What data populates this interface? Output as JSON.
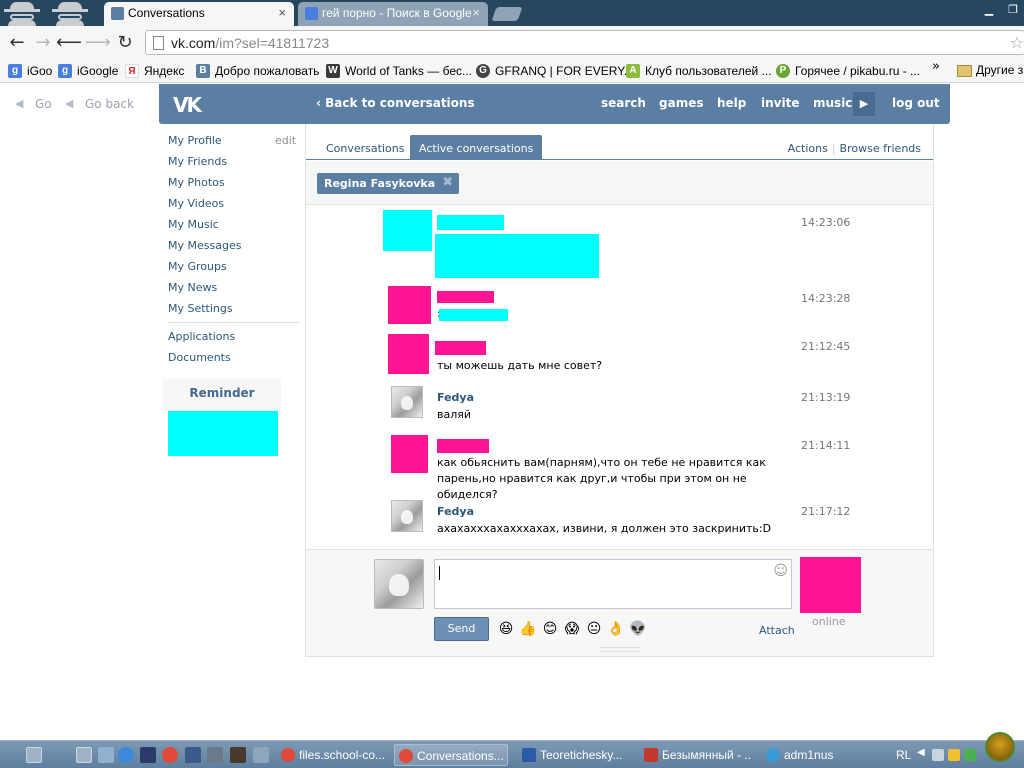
{
  "browser": {
    "tabs": [
      {
        "title": "Conversations",
        "active": true,
        "favicon_color": "#5b7ea3"
      },
      {
        "title": "гей порно - Поиск в Google",
        "active": false,
        "favicon_color": "#4a7de0"
      }
    ],
    "close_glyph": "×",
    "address": {
      "host": "vk.com",
      "path": "/im?sel=41811723"
    },
    "nav": {
      "back": "←",
      "forward": "→",
      "back2": "⟵",
      "forward2": "⟶",
      "reload": "↻"
    },
    "bookmarks": [
      {
        "label": "iGoo",
        "icon_color": "#4a7de0",
        "icon_glyph": "g"
      },
      {
        "label": "iGoogle",
        "icon_color": "#4a7de0",
        "icon_glyph": "g"
      },
      {
        "label": "Яндекс",
        "icon_color": "#ffffff",
        "icon_glyph": "Я"
      },
      {
        "label": "Добро пожаловать",
        "icon_color": "#5b7ea3",
        "icon_glyph": "B"
      },
      {
        "label": "World of Tanks — бес...",
        "icon_color": "#3a3a3a",
        "icon_glyph": "W"
      },
      {
        "label": "GFRANQ | FOR EVERY...",
        "icon_color": "#444444",
        "icon_glyph": "G"
      },
      {
        "label": "Клуб пользователей ...",
        "icon_color": "#8bbd3a",
        "icon_glyph": "A"
      },
      {
        "label": "Горячее / pikabu.ru - ...",
        "icon_color": "#6aa533",
        "icon_glyph": "P"
      }
    ],
    "bookmarks_more": "»",
    "other_bookmarks": "Другие з"
  },
  "vk": {
    "go_links": {
      "go": "Go",
      "go_back": "Go back"
    },
    "logo": "VK",
    "back_to_conversations": "Back to conversations",
    "top_nav": [
      "search",
      "games",
      "help",
      "invite",
      "music",
      "log out"
    ],
    "sidebar": {
      "edit": "edit",
      "items": [
        "My Profile",
        "My Friends",
        "My Photos",
        "My Videos",
        "My Music",
        "My Messages",
        "My Groups",
        "My News",
        "My Settings"
      ],
      "extra": [
        "Applications",
        "Documents"
      ],
      "reminder": "Reminder"
    },
    "tabs": [
      "Conversations",
      "Active conversations"
    ],
    "actions": [
      "Actions",
      "Browse friends"
    ],
    "recipient": "Regina Fasykovka",
    "messages": [
      {
        "name": "",
        "text": "",
        "time": "14:23:06"
      },
      {
        "name": "",
        "text": ":",
        "time": "14:23:28"
      },
      {
        "name": "",
        "text": "ты можешь дать мне совет?",
        "time": "21:12:45"
      },
      {
        "name": "Fedya",
        "text": "валяй",
        "time": "21:13:19"
      },
      {
        "name": "",
        "text": "как обьяснить вам(парням),что он тебе не нравится как парень,но нравится как друг,и чтобы при этом он не обиделся?",
        "time": "21:14:11"
      },
      {
        "name": "Fedya",
        "text": "ахахахххахахххахах, извини, я должен это заскринить:D",
        "time": "21:17:12"
      }
    ],
    "composer": {
      "send": "Send",
      "attach": "Attach",
      "online": "online",
      "emoji": [
        "😆",
        "👍",
        "😊",
        "😱",
        "😐",
        "👌",
        "👽"
      ]
    },
    "colors": {
      "header": "#5b7ea3",
      "link": "#2b587a",
      "redact_pink": "#ff1493",
      "redact_cyan": "#00ffff"
    }
  },
  "taskbar": {
    "items": [
      {
        "label": "files.school-co...",
        "active": false,
        "icon_color": "#e04a3a"
      },
      {
        "label": "Conversations...",
        "active": true,
        "icon_color": "#e04a3a"
      },
      {
        "label": "Teoretichesky...",
        "active": false,
        "icon_color": "#2a5aa8"
      },
      {
        "label": "Безымянный - ...",
        "active": false,
        "icon_color": "#c0392b"
      },
      {
        "label": "adm1nus",
        "active": false,
        "icon_color": "#3a9ad9"
      }
    ],
    "lang": "RL"
  }
}
